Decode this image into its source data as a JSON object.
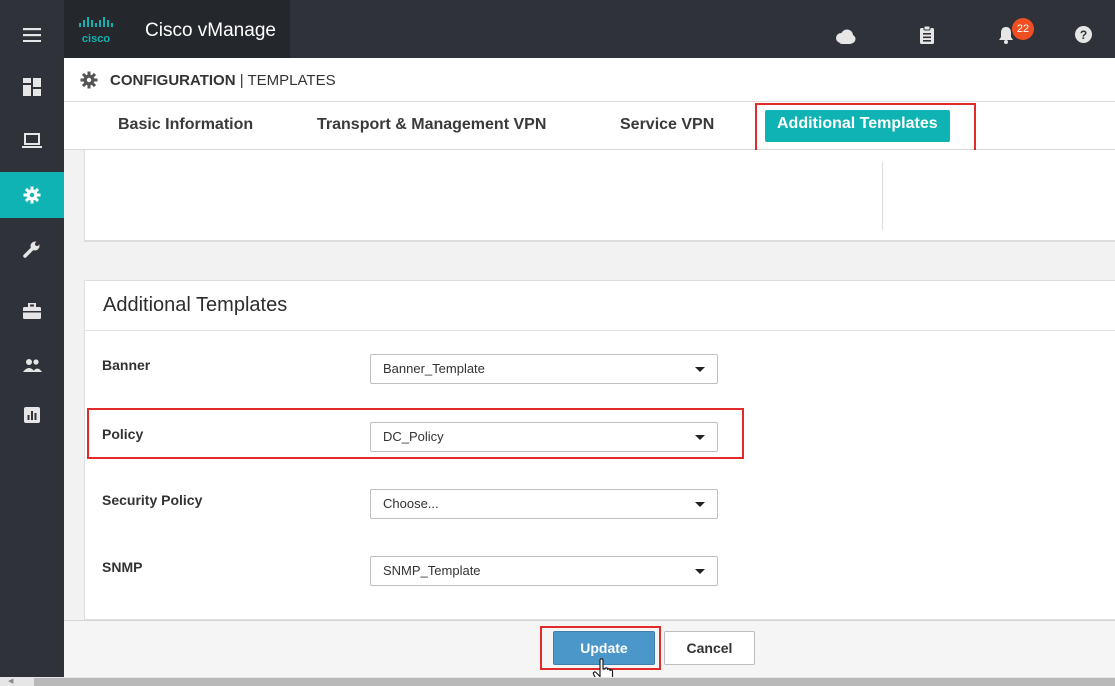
{
  "app": {
    "title": "Cisco vManage",
    "logo_text": "cisco",
    "notification_count": "22"
  },
  "colors": {
    "accent": "#10b3b3",
    "topbar": "#2f3238",
    "highlight": "#e12a2a",
    "primary_button": "#4b97c9"
  },
  "sidebar": {
    "items": [
      {
        "name": "menu",
        "icon": "hamburger-icon"
      },
      {
        "name": "dashboard",
        "icon": "dashboard-icon"
      },
      {
        "name": "monitor",
        "icon": "laptop-icon"
      },
      {
        "name": "configuration",
        "icon": "gear-icon",
        "active": true
      },
      {
        "name": "tools",
        "icon": "wrench-icon"
      },
      {
        "name": "maintenance",
        "icon": "briefcase-icon"
      },
      {
        "name": "administration",
        "icon": "users-icon"
      },
      {
        "name": "analytics",
        "icon": "chart-icon"
      }
    ]
  },
  "header": {
    "section": "CONFIGURATION",
    "separator": " | ",
    "subsection": "TEMPLATES"
  },
  "tabs": [
    {
      "label": "Basic Information"
    },
    {
      "label": "Transport & Management VPN"
    },
    {
      "label": "Service VPN"
    },
    {
      "label": "Additional Templates",
      "active": true
    }
  ],
  "panel": {
    "title": "Additional Templates",
    "rows": [
      {
        "label": "Banner",
        "value": "Banner_Template"
      },
      {
        "label": "Policy",
        "value": "DC_Policy"
      },
      {
        "label": "Security Policy",
        "value": "Choose..."
      },
      {
        "label": "SNMP",
        "value": "SNMP_Template"
      }
    ]
  },
  "footer": {
    "update_label": "Update",
    "cancel_label": "Cancel"
  }
}
